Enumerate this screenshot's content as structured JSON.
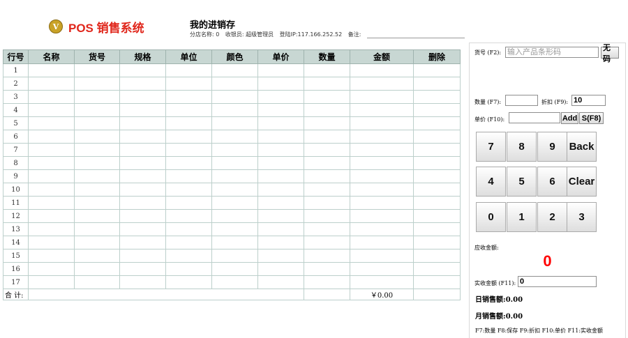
{
  "header": {
    "logo_letter": "V",
    "logo_text": "POS 销售系统",
    "page_title": "我的进销存",
    "info": {
      "branch": "分店名称: 0",
      "cashier": "收银员: 超级管理员",
      "login_ip": "登陆IP:117.166.252.52",
      "remark": "备注:"
    }
  },
  "table": {
    "columns": [
      "行号",
      "名称",
      "货号",
      "规格",
      "单位",
      "颜色",
      "单价",
      "数量",
      "金额",
      "删除"
    ],
    "row_numbers": [
      "1",
      "2",
      "3",
      "4",
      "5",
      "6",
      "7",
      "8",
      "9",
      "10",
      "11",
      "12",
      "13",
      "14",
      "15",
      "16",
      "17"
    ],
    "total_label": "合 计:",
    "total_amount": "￥0.00"
  },
  "panel": {
    "sku_label": "货号 (F2):",
    "sku_placeholder": "输入产品条形码",
    "no_code_button": "无码",
    "qty_label": "数量 (F7):",
    "qty_value": "",
    "discount_label": "折扣 (F9):",
    "discount_value": "10",
    "price_label": "单价 (F10):",
    "price_value": "",
    "add_button": "Add",
    "save_button": "S(F8)",
    "keypad": [
      "7",
      "8",
      "9",
      "Back",
      "4",
      "5",
      "6",
      "Clear",
      "0",
      "1",
      "2",
      "3"
    ],
    "due_label": "应收金额:",
    "due_amount": "0",
    "received_label": "实收金额 (F11):",
    "received_value": "0",
    "daily_sales": "日销售额:0.00",
    "monthly_sales": "月销售额:0.00",
    "hotkeys_hint": "F7:数量 F8:保存 F9:折扣 F10:单价 F11:实收金额"
  },
  "colors": {
    "brand_red": "#e0261b",
    "table_header_bg": "#c8d7d3",
    "due_red": "#ff0000"
  }
}
